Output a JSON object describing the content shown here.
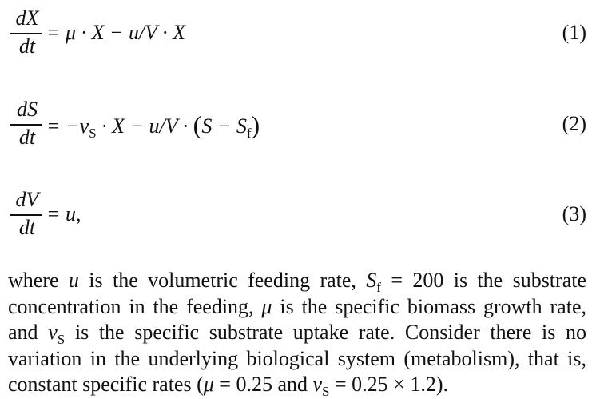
{
  "equations": [
    {
      "lhs_num": "dX",
      "lhs_den": "dt",
      "rhs": "=  μ · X − u/V · X",
      "number": "(1)"
    },
    {
      "lhs_num": "dS",
      "lhs_den": "dt",
      "rhs_a": "=  −v",
      "rhs_a_sub": "S",
      "rhs_b": " · X − u/V · ",
      "paren_open": "(",
      "rhs_c": "S − S",
      "rhs_c_sub": "f",
      "paren_close": ")",
      "number": "(2)"
    },
    {
      "lhs_num": "dV",
      "lhs_den": "dt",
      "rhs": "=  u,",
      "number": "(3)"
    }
  ],
  "paragraph": {
    "t1": "where ",
    "u": "u",
    "t2": " is the volumetric feeding rate, ",
    "sf_S": "S",
    "sf_sub": "f",
    "t3": " =  200 is the substrate concentration in the feeding, ",
    "mu": "μ",
    "t4": " is the specific biomass growth rate, and ",
    "vs_v": "v",
    "vs_sub": "S",
    "t5": " is the specific substrate uptake rate. Consider there is no variation in the underlying biological system (metabolism), that is, constant specific rates (",
    "mu2": "μ",
    "t6": "  =  0.25 and ",
    "vs2_v": "v",
    "vs2_sub": "S",
    "t7": "  =  0.25  ×  1.2)."
  }
}
